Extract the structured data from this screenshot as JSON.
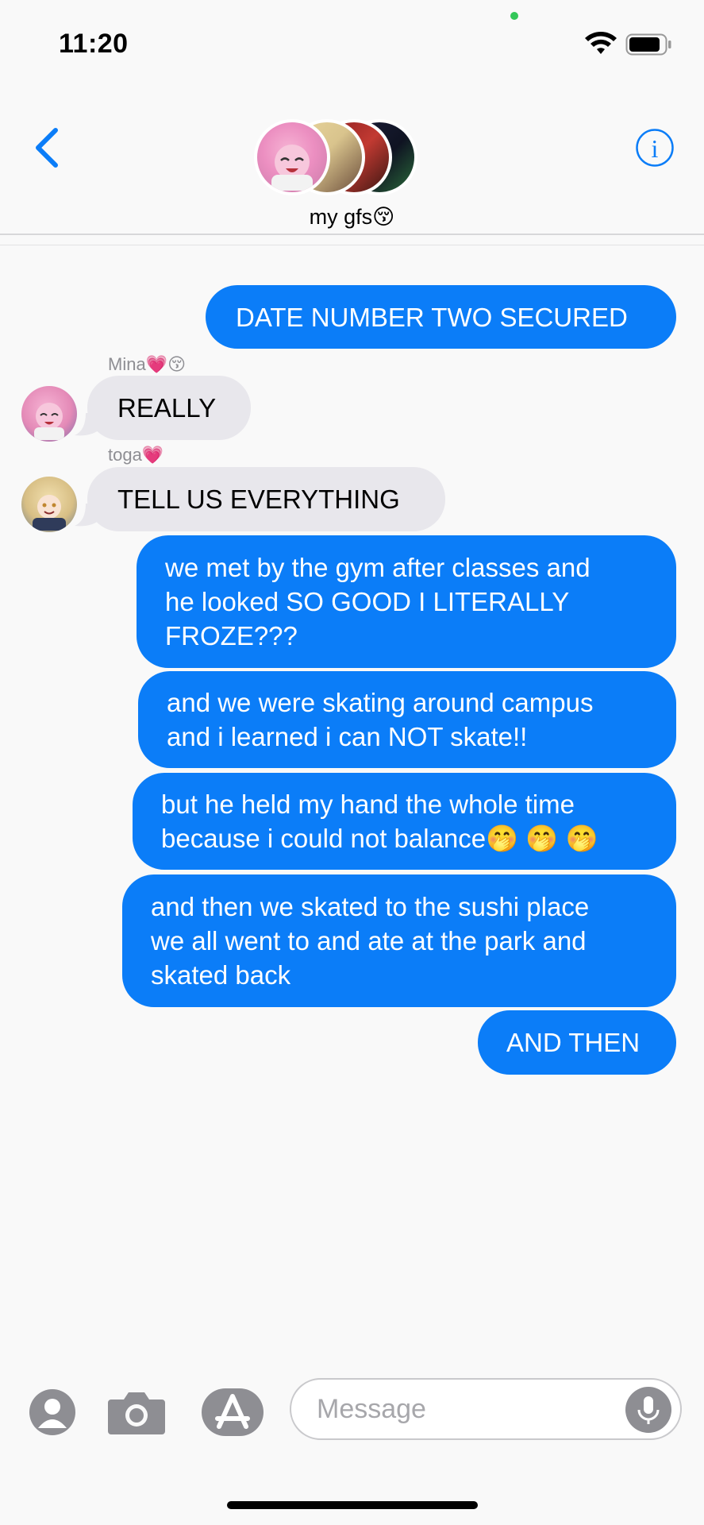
{
  "status": {
    "time": "11:20"
  },
  "header": {
    "group_name": "my gfs😚"
  },
  "messages": [
    {
      "text": "DATE NUMBER TWO SECURED"
    },
    {
      "sender": "Mina💗😚",
      "text": "REALLY"
    },
    {
      "sender": "toga💗",
      "text": "TELL US EVERYTHING"
    },
    {
      "line1": "we met by the gym after classes and",
      "line2": "he looked SO GOOD I LITERALLY",
      "line3": "FROZE???"
    },
    {
      "line1": "and we were skating around campus",
      "line2": "and i learned i can NOT skate!!"
    },
    {
      "line1": "but he held my hand the whole time",
      "line2": "because i could not balance🤭 🤭 🤭"
    },
    {
      "line1": "and then we skated to the sushi place",
      "line2": "we all went to and ate at the park and",
      "line3": "skated back"
    },
    {
      "text": "AND THEN"
    }
  ],
  "composer": {
    "placeholder": "Message"
  },
  "colors": {
    "outgoing": "#0b7df8",
    "incoming": "#e8e7ec",
    "accent": "#0b7df8"
  },
  "icons": [
    "wifi-icon",
    "battery-icon",
    "back-chevron-icon",
    "info-icon",
    "contact-icon",
    "camera-icon",
    "app-store-icon",
    "microphone-icon"
  ]
}
